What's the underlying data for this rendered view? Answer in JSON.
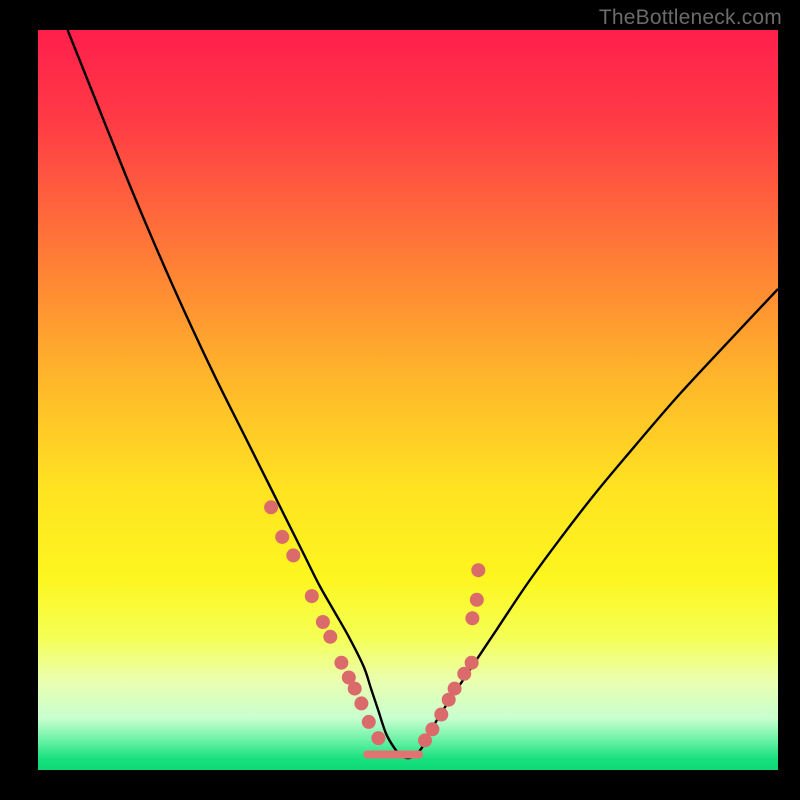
{
  "watermark": "TheBottleneck.com",
  "chart_data": {
    "type": "line",
    "title": "",
    "xlabel": "",
    "ylabel": "",
    "xlim": [
      0,
      100
    ],
    "ylim": [
      0,
      100
    ],
    "note": "No numeric axis ticks or labels are visible in the image; x and y are normalized 0–100 across the plot area. The curve is a V-shaped bottleneck curve with a flat green zone near the bottom and scattered pink markers along the lower portions of both arms.",
    "gradient_stops": [
      {
        "pos": 0.0,
        "color": "#ff1f4b"
      },
      {
        "pos": 0.12,
        "color": "#ff3a46"
      },
      {
        "pos": 0.3,
        "color": "#ff7a37"
      },
      {
        "pos": 0.48,
        "color": "#ffb92a"
      },
      {
        "pos": 0.62,
        "color": "#ffe321"
      },
      {
        "pos": 0.74,
        "color": "#fdf61f"
      },
      {
        "pos": 0.82,
        "color": "#f5ff54"
      },
      {
        "pos": 0.88,
        "color": "#eaffb0"
      },
      {
        "pos": 0.93,
        "color": "#c9ffd0"
      },
      {
        "pos": 0.965,
        "color": "#59ef9e"
      },
      {
        "pos": 0.985,
        "color": "#18e07e"
      },
      {
        "pos": 1.0,
        "color": "#0fd877"
      }
    ],
    "series": [
      {
        "name": "bottleneck-curve",
        "x": [
          4,
          8,
          12,
          16,
          20,
          24,
          28,
          30,
          32,
          34,
          36,
          38,
          40,
          42,
          44,
          45,
          46,
          47,
          48,
          49,
          50,
          51,
          52,
          53,
          55,
          58,
          62,
          66,
          70,
          75,
          80,
          86,
          92,
          100
        ],
        "y": [
          100,
          90,
          80,
          70.5,
          61.5,
          53,
          45,
          41,
          37,
          33,
          29,
          25,
          21.5,
          18,
          14,
          11,
          8,
          5,
          3.2,
          2,
          1.6,
          2,
          3.2,
          5.2,
          8.5,
          13,
          19,
          25,
          30.5,
          37,
          43,
          50,
          56.5,
          65
        ],
        "note": "y is bottleneck percentage (0 at bottom green zone, 100 at top red). Values are estimated from pixel position since no axis labels are shown."
      }
    ],
    "flat_segment": {
      "name": "optimal-zone-flat",
      "x_start": 44.5,
      "x_end": 51.5,
      "y": 2.1,
      "color": "#e17373",
      "thickness_px": 8
    },
    "markers": {
      "name": "sample-points",
      "color": "#db6b6b",
      "radius_px": 7,
      "points": [
        {
          "x": 31.5,
          "y": 35.5
        },
        {
          "x": 33.0,
          "y": 31.5
        },
        {
          "x": 34.5,
          "y": 29.0
        },
        {
          "x": 37.0,
          "y": 23.5
        },
        {
          "x": 38.5,
          "y": 20.0
        },
        {
          "x": 39.5,
          "y": 18.0
        },
        {
          "x": 41.0,
          "y": 14.5
        },
        {
          "x": 42.0,
          "y": 12.5
        },
        {
          "x": 42.8,
          "y": 11.0
        },
        {
          "x": 43.7,
          "y": 9.0
        },
        {
          "x": 44.7,
          "y": 6.5
        },
        {
          "x": 46.0,
          "y": 4.3
        },
        {
          "x": 52.3,
          "y": 4.0
        },
        {
          "x": 53.3,
          "y": 5.5
        },
        {
          "x": 54.5,
          "y": 7.5
        },
        {
          "x": 55.5,
          "y": 9.5
        },
        {
          "x": 56.3,
          "y": 11.0
        },
        {
          "x": 57.6,
          "y": 13.0
        },
        {
          "x": 58.6,
          "y": 14.5
        },
        {
          "x": 58.7,
          "y": 20.5
        },
        {
          "x": 59.3,
          "y": 23.0
        },
        {
          "x": 59.5,
          "y": 27.0
        }
      ]
    }
  }
}
